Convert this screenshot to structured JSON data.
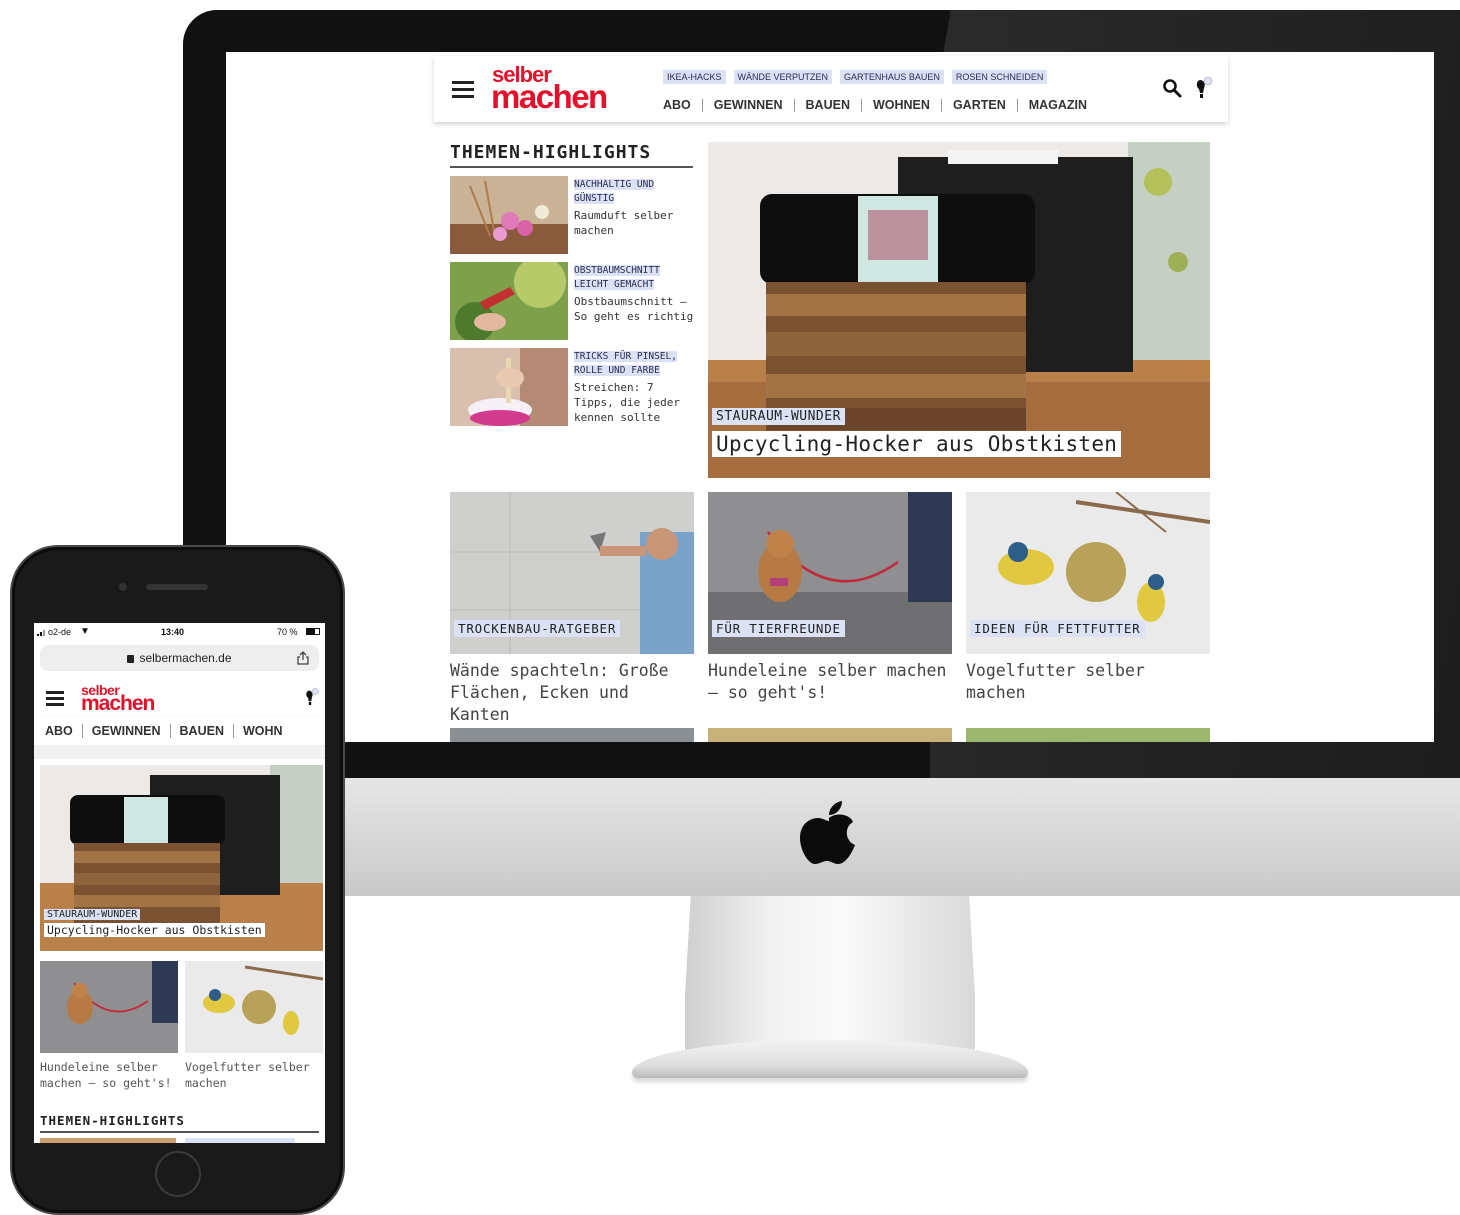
{
  "desktop": {
    "logo": {
      "line1": "selber",
      "line2": "machen"
    },
    "tags": [
      "IKEA-HACKS",
      "WÄNDE VERPUTZEN",
      "GARTENHAUS BAUEN",
      "ROSEN SCHNEIDEN"
    ],
    "nav": [
      "ABO",
      "GEWINNEN",
      "BAUEN",
      "WOHNEN",
      "GARTEN",
      "MAGAZIN"
    ],
    "highlights": {
      "title": "THEMEN-HIGHLIGHTS",
      "items": [
        {
          "kicker": "NACHHALTIG UND GÜNSTIG",
          "text": "Raumduft selber machen"
        },
        {
          "kicker": "OBSTBAUMSCHNITT LEICHT GEMACHT",
          "text": "Obstbaumschnitt – So geht es richtig"
        },
        {
          "kicker": "TRICKS FÜR PINSEL, ROLLE UND FARBE",
          "text": "Streichen: 7 Tipps, die jeder kennen sollte"
        }
      ]
    },
    "hero": {
      "kicker": "STAURAUM-WUNDER",
      "title": "Upcycling-Hocker aus Obstkisten"
    },
    "cards": [
      {
        "kicker": "TROCKENBAU-RATGEBER",
        "title": "Wände spachteln: Große Flächen, Ecken und Kanten"
      },
      {
        "kicker": "FÜR TIERFREUNDE",
        "title": "Hundeleine selber machen – so geht's!"
      },
      {
        "kicker": "IDEEN FÜR FETTFUTTER",
        "title": "Vogelfutter selber machen"
      }
    ]
  },
  "phone": {
    "status": {
      "carrier": "o2-de",
      "time": "13:40",
      "battery": "70 %"
    },
    "url": "selbermachen.de",
    "logo": {
      "line1": "selber",
      "line2": "machen"
    },
    "nav": [
      "ABO",
      "GEWINNEN",
      "BAUEN",
      "WOHN"
    ],
    "hero": {
      "kicker": "STAURAUM-WUNDER",
      "title": "Upcycling-Hocker aus Obstkisten"
    },
    "cards": [
      {
        "title": "Hundeleine selber machen – so geht's!"
      },
      {
        "title": "Vogelfutter selber machen"
      }
    ],
    "highlights_title": "THEMEN-HIGHLIGHTS"
  },
  "colors": {
    "brand_red": "#e1122a",
    "tag_bg": "#dbe2f5",
    "bezel": "#111111"
  },
  "icons": [
    "menu-icon",
    "search-icon",
    "lightbulb-icon",
    "lock-icon",
    "share-icon",
    "apple-logo-icon",
    "wifi-icon",
    "signal-icon",
    "battery-icon"
  ]
}
